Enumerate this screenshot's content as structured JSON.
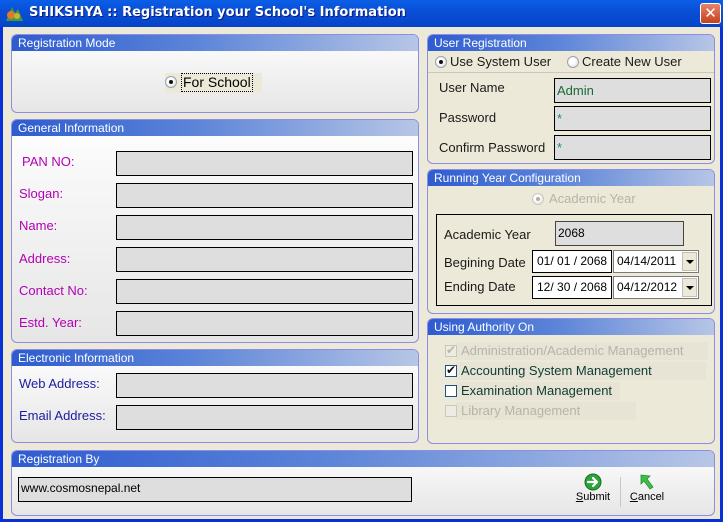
{
  "window": {
    "title": "SHIKSHYA :: Registration your School's Information",
    "app_icon": "shikshya-logo-icon",
    "close_icon": "close-icon",
    "close_glyph": "✕"
  },
  "registration_mode": {
    "heading": "Registration Mode",
    "option_label": "For School",
    "selected": true
  },
  "general_information": {
    "heading": "General Information",
    "fields": [
      {
        "label": "PAN NO:",
        "value": ""
      },
      {
        "label": "Slogan:",
        "value": ""
      },
      {
        "label": "Name:",
        "value": ""
      },
      {
        "label": "Address:",
        "value": ""
      },
      {
        "label": "Contact No:",
        "value": ""
      },
      {
        "label": "Estd. Year:",
        "value": ""
      }
    ]
  },
  "electronic_information": {
    "heading": "Electronic Information",
    "fields": [
      {
        "label": "Web Address:",
        "value": ""
      },
      {
        "label": "Email Address:",
        "value": ""
      }
    ]
  },
  "user_registration": {
    "heading": "User Registration",
    "options": [
      {
        "label": "Use System User",
        "selected": true
      },
      {
        "label": "Create New User",
        "selected": false
      }
    ],
    "fields": [
      {
        "label": "User Name",
        "value": "Admin"
      },
      {
        "label": "Password",
        "value": "*"
      },
      {
        "label": "Confirm Password",
        "value": "*"
      }
    ]
  },
  "running_year": {
    "heading": "Running Year Configuration",
    "option_label": "Academic Year",
    "option_selected": true,
    "option_disabled": true,
    "academic_year_label": "Academic Year",
    "academic_year_value": "2068",
    "beginning_label": "Begining Date",
    "beginning_bs": "01/ 01 / 2068",
    "beginning_ad": "04/14/2011",
    "ending_label": "Ending Date",
    "ending_bs": "12/ 30 / 2068",
    "ending_ad": "04/12/2012"
  },
  "authority": {
    "heading": "Using Authority On",
    "items": [
      {
        "label": "Administration/Academic Management",
        "checked": true,
        "disabled": true
      },
      {
        "label": "Accounting System Management",
        "checked": true,
        "disabled": false
      },
      {
        "label": "Examination Management",
        "checked": false,
        "disabled": false
      },
      {
        "label": "Library Management",
        "checked": false,
        "disabled": true
      }
    ],
    "check_glyph": "✔"
  },
  "registration_by": {
    "heading": "Registration By",
    "value": "www.cosmosnepal.net"
  },
  "actions": {
    "submit_mnemonic": "S",
    "submit_rest": "ubmit",
    "cancel_mnemonic": "C",
    "cancel_rest": "ancel"
  },
  "colors": {
    "title_bar": "#0a4fd8",
    "group_header": "#2e5cd0",
    "label_magenta": "#b400b4",
    "label_navy": "#1c1ca0",
    "field_bg": "#dedede"
  }
}
